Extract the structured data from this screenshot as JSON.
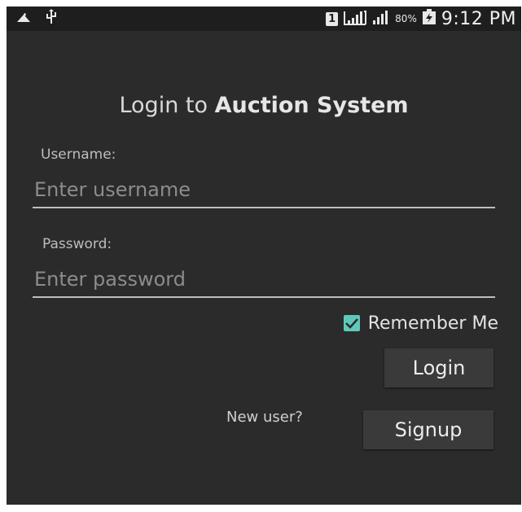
{
  "status_bar": {
    "left_icons": [
      "notification-icon",
      "usb-icon"
    ],
    "sim_label": "1",
    "battery_percent": "80%",
    "time": "9:12 PM"
  },
  "login": {
    "title_prefix": "Login to",
    "title_strong": "Auction System",
    "username_label": "Username:",
    "username_placeholder": "Enter username",
    "username_value": "",
    "password_label": "Password:",
    "password_placeholder": "Enter password",
    "password_value": "",
    "remember_me_label": "Remember Me",
    "remember_me_checked": true,
    "login_button": "Login",
    "new_user_text": "New user?",
    "signup_button": "Signup"
  },
  "colors": {
    "background": "#2b2b2b",
    "status_bar": "#1e1e1e",
    "checkbox_accent": "#5fc9b9"
  }
}
